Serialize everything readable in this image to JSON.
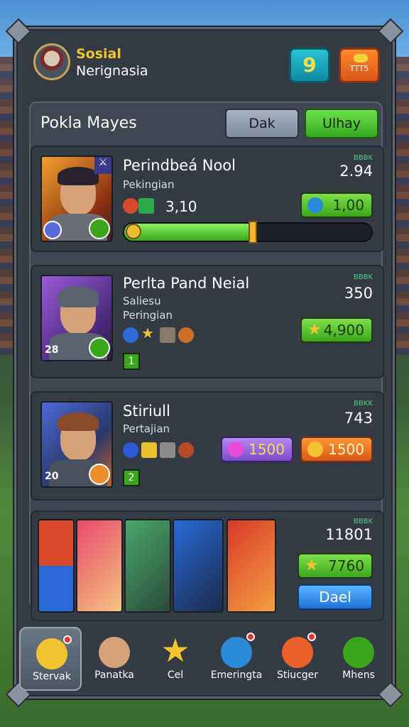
{
  "header": {
    "title": "Sosial",
    "subtitle": "Nerignasia",
    "level": "9",
    "currency": "TTT5"
  },
  "section": {
    "title": "Pokla Mayes",
    "btn_left": "Dak",
    "btn_right": "Ulhay"
  },
  "cards": [
    {
      "name": "Perindbeá Nool",
      "sub1": "Pekingian",
      "sub2": "",
      "tag": "BBBK",
      "num": "2.94",
      "stat": "3,10",
      "price": "1,00",
      "progress": 0.52
    },
    {
      "name": "Perlta Pand Neial",
      "sub1": "Saliesu",
      "sub2": "Peringian",
      "tag": "BBBK",
      "num": "350",
      "level": "1",
      "price": "4,900",
      "portrait_num": "28"
    },
    {
      "name": "Stiriull",
      "sub1": "Pertajian",
      "tag": "BBKK",
      "num": "743",
      "level": "2",
      "price_purple": "1500",
      "price_orange": "1500",
      "portrait_num": "20"
    },
    {
      "tag": "BBBK",
      "num": "11801",
      "price": "7760",
      "btn": "Dael"
    }
  ],
  "nav": [
    {
      "label": "Stervak"
    },
    {
      "label": "Panatka"
    },
    {
      "label": "Cel"
    },
    {
      "label": "Emeringta"
    },
    {
      "label": "Stiucger"
    },
    {
      "label": "Mhens"
    }
  ]
}
